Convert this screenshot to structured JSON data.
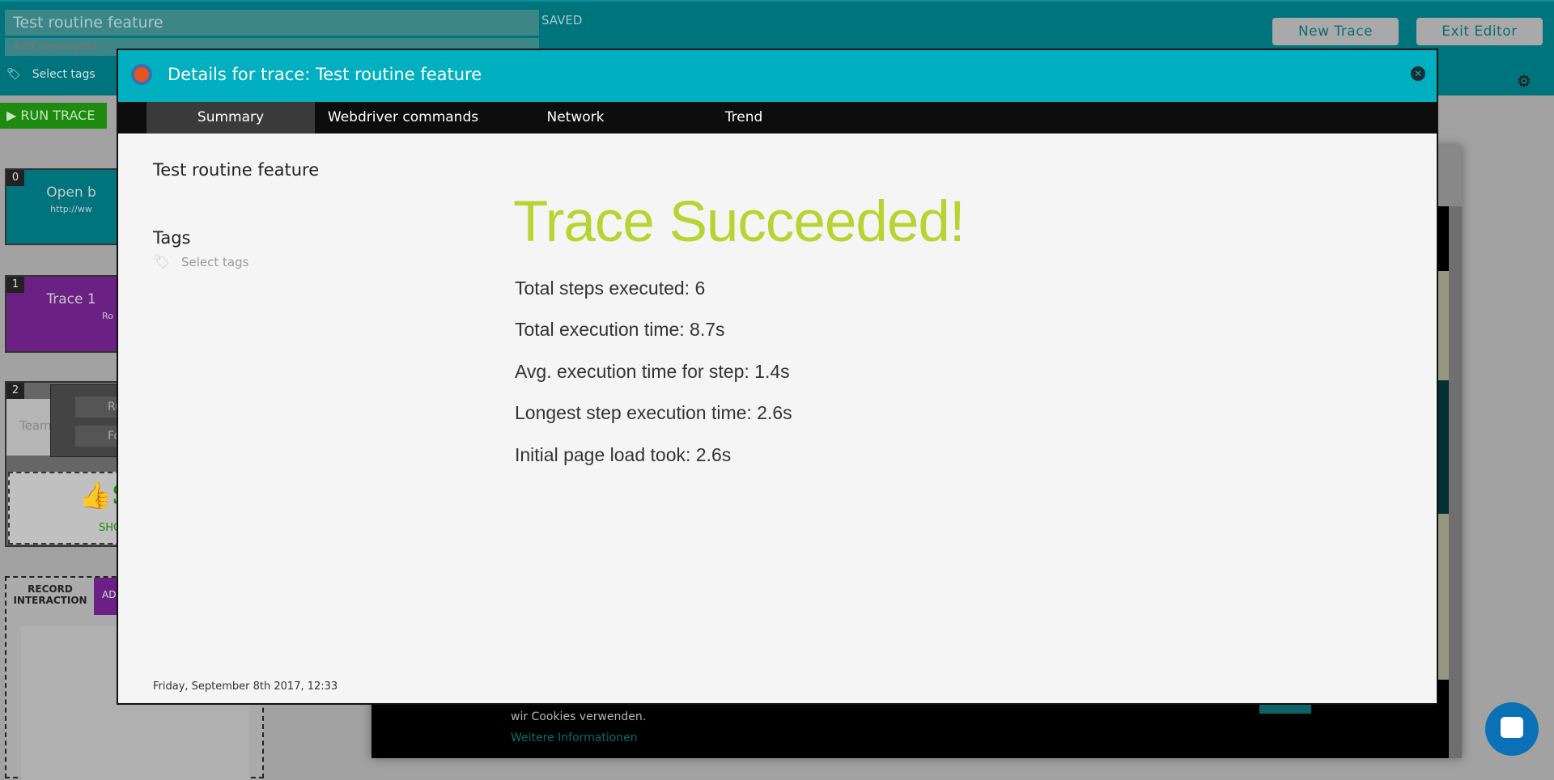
{
  "topbar": {
    "title_value": "Test routine feature",
    "description_placeholder": "Add description",
    "saved_label": "SAVED",
    "tags_label": "Select tags",
    "new_trace": "New Trace",
    "exit_editor": "Exit Editor",
    "run_trace": "▶ RUN TRACE"
  },
  "steps": [
    {
      "index": "0",
      "title": "Open b",
      "sub": "http://ww",
      "color": "#00747c"
    },
    {
      "index": "1",
      "title": "Trace 1",
      "sub": "Ro",
      "color": "#6a2183"
    },
    {
      "index": "2",
      "left": "Team",
      "btn1": "Ru",
      "btn2": "Fo",
      "success": "S",
      "show": "SHO"
    }
  ],
  "record": {
    "label": "RECORD INTERACTION",
    "add": "ADI"
  },
  "cookie": {
    "text": "wir Cookies verwenden.",
    "link": "Weitere Informationen"
  },
  "modal": {
    "title": "Details for trace: Test routine feature",
    "tabs": [
      {
        "label": "Summary",
        "active": true
      },
      {
        "label": "Webdriver commands"
      },
      {
        "label": "Network"
      },
      {
        "label": "Trend"
      }
    ],
    "trace_name": "Test routine feature",
    "tags_heading": "Tags",
    "tags_placeholder": "Select tags",
    "status": "Trace Succeeded!",
    "stats": [
      "Total steps executed: 6",
      "Total execution time: 8.7s",
      "Avg. execution time for step: 1.4s",
      "Longest step execution time: 2.6s",
      "Initial page load took: 2.6s"
    ],
    "date": "Friday, September 8th 2017, 12:33"
  },
  "colors": {
    "teal": "#00747c",
    "modal_header": "#00b0c0",
    "success": "#b8d432",
    "run": "#1e8a0f"
  }
}
